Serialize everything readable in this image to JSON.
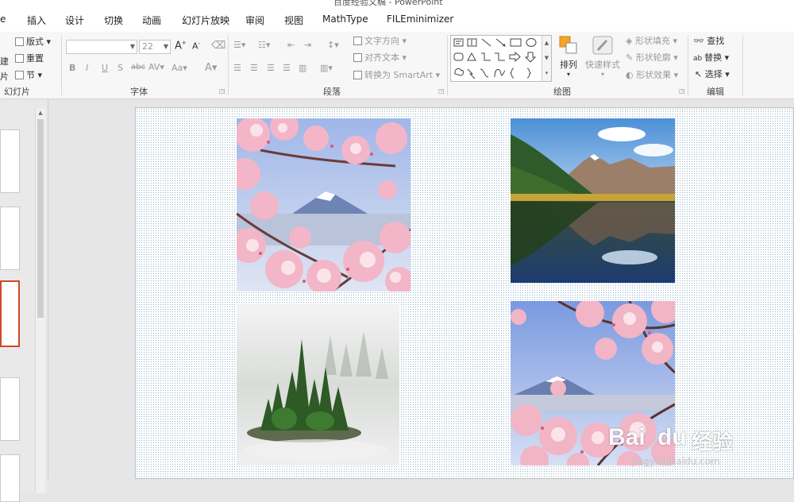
{
  "titlebar": {
    "title": "百度经验文稿 - PowerPoint"
  },
  "tabs": [
    "e",
    "插入",
    "设计",
    "切换",
    "动画",
    "幻灯片放映",
    "审阅",
    "视图",
    "MathType",
    "FILEminimizer"
  ],
  "ribbon": {
    "slides_group": {
      "layout": "版式",
      "reset": "重置",
      "section": "节",
      "new_partial_1": "建",
      "new_partial_2": "片",
      "label": "幻灯片"
    },
    "font_group": {
      "font_name": "",
      "font_size": "22",
      "grow": "A",
      "shrink": "A",
      "label": "字体",
      "bold": "B",
      "italic": "I",
      "underline": "U",
      "shadow": "S",
      "strike": "abc",
      "spacing": "AV",
      "case": "Aa",
      "color": "A"
    },
    "paragraph_group": {
      "text_direction": "文字方向",
      "align_text": "对齐文本",
      "smartart": "转换为 SmartArt",
      "label": "段落"
    },
    "drawing_group": {
      "arrange": "排列",
      "quick_styles": "快速样式",
      "shape_fill": "形状填充",
      "shape_outline": "形状轮廓",
      "shape_effects": "形状效果",
      "label": "绘图"
    },
    "editing_group": {
      "find": "查找",
      "replace": "替换",
      "select": "选择",
      "label": "编辑"
    }
  },
  "watermark": {
    "brand": "Bai",
    "brand2": "du",
    "cn": "经验",
    "url": "jingyan.baidu.com"
  },
  "colors": {
    "accent": "#d24726",
    "ribbon_bg": "#f7f7f7",
    "slide_dots": "#8fb3c7"
  }
}
